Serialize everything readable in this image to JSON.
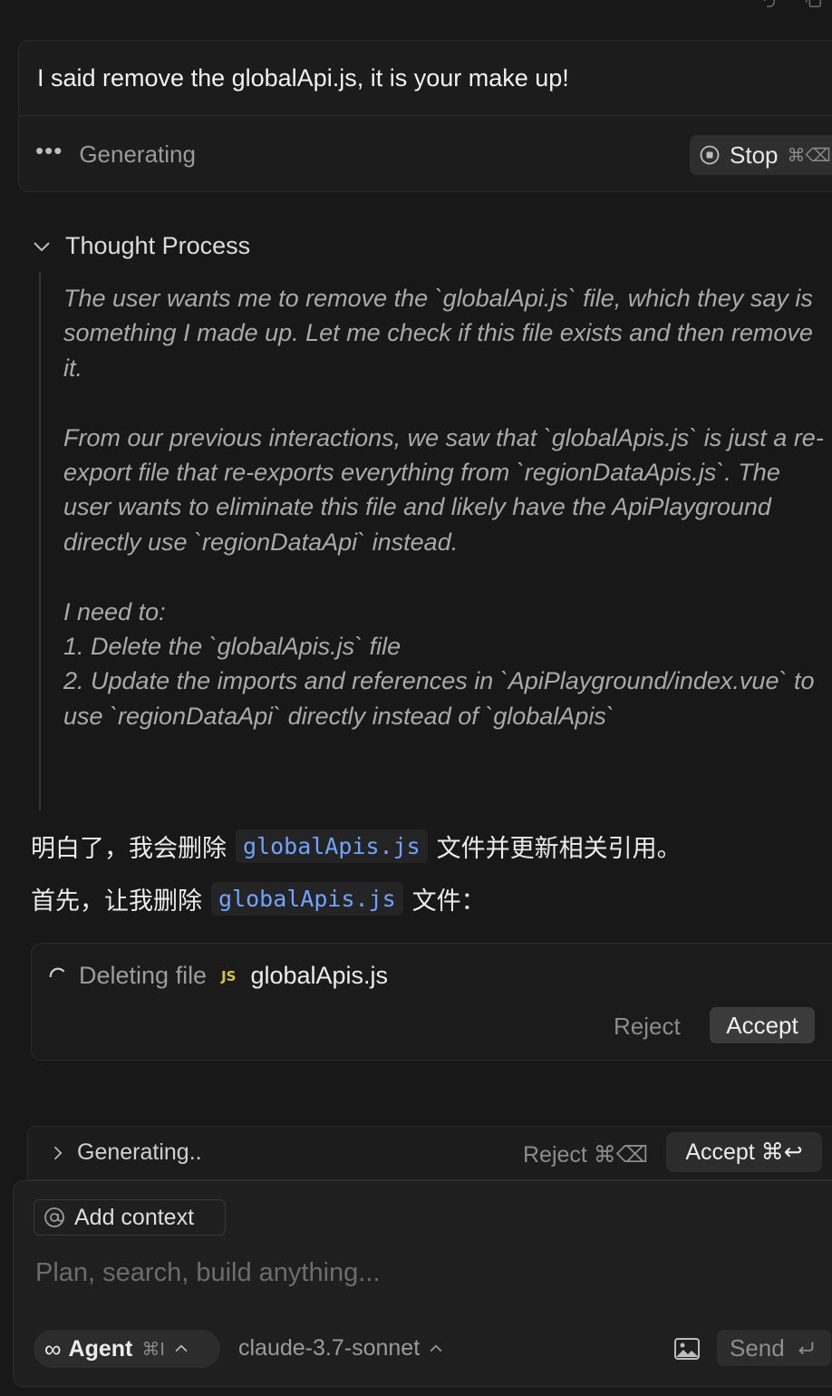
{
  "user_message": {
    "text": "I said remove the globalApi.js, it is your make up!",
    "status": "Generating",
    "stop_label": "Stop",
    "stop_shortcut": "⌘⌫"
  },
  "thought": {
    "header": "Thought Process",
    "paragraphs": [
      "The user wants me to remove the `globalApi.js` file, which they say is something I made up. Let me check if this file exists and then remove it.",
      "From our previous interactions, we saw that `globalApis.js` is just a re-export file that re-exports everything from `regionDataApis.js`. The user wants to eliminate this file and likely have the ApiPlayground directly use `regionDataApi` instead.",
      "I need to:\n1. Delete the `globalApis.js` file\n2. Update the imports and references in `ApiPlayground/index.vue` to use `regionDataApi` directly instead of `globalApis`"
    ]
  },
  "assistant": {
    "line1_pre": "明白了，我会删除",
    "line1_code": "globalApis.js",
    "line1_post": "文件并更新相关引用。",
    "line2_pre": "首先，让我删除",
    "line2_code": "globalApis.js",
    "line2_post": "文件："
  },
  "delete_card": {
    "label": "Deleting file",
    "badge": "JS",
    "filename": "globalApis.js",
    "reject_label": "Reject",
    "accept_label": "Accept"
  },
  "generating_bar": {
    "label": "Generating..",
    "reject_label": "Reject ⌘⌫",
    "accept_label": "Accept ⌘↩"
  },
  "composer": {
    "add_context_label": "Add context",
    "placeholder": "Plan, search, build anything...",
    "mode_label": "Agent",
    "mode_shortcut": "⌘I",
    "model_label": "claude-3.7-sonnet",
    "send_label": "Send"
  },
  "colors": {
    "background": "#181818",
    "code_text": "#6fa3ff",
    "js_badge": "#d9c44a"
  }
}
